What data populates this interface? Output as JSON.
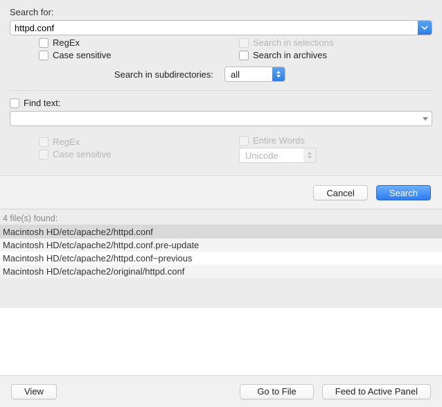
{
  "search": {
    "label": "Search for:",
    "value": "httpd.conf",
    "options": {
      "regex": {
        "label": "RegEx",
        "checked": false
      },
      "case_sensitive": {
        "label": "Case sensitive",
        "checked": false
      },
      "search_in_selections": {
        "label": "Search in selections",
        "checked": false,
        "enabled": false
      },
      "search_in_archives": {
        "label": "Search in archives",
        "checked": false
      }
    },
    "subdirectories": {
      "label": "Search in subdirectories:",
      "value": "all"
    }
  },
  "find_text": {
    "label": "Find text:",
    "checked": false,
    "value": "",
    "options": {
      "regex": {
        "label": "RegEx",
        "checked": false,
        "enabled": false
      },
      "case_sensitive": {
        "label": "Case sensitive",
        "checked": false,
        "enabled": false
      },
      "entire_words": {
        "label": "Entire Words",
        "checked": false,
        "enabled": false
      }
    },
    "encoding": {
      "value": "Unicode",
      "enabled": false
    }
  },
  "buttons": {
    "cancel": "Cancel",
    "search": "Search",
    "view": "View",
    "go_to_file": "Go to File",
    "feed": "Feed to Active Panel"
  },
  "results": {
    "count_label": "4 file(s) found:",
    "items": [
      "Macintosh HD/etc/apache2/httpd.conf",
      "Macintosh HD/etc/apache2/httpd.conf.pre-update",
      "Macintosh HD/etc/apache2/httpd.conf~previous",
      "Macintosh HD/etc/apache2/original/httpd.conf"
    ],
    "selected_index": 0
  }
}
